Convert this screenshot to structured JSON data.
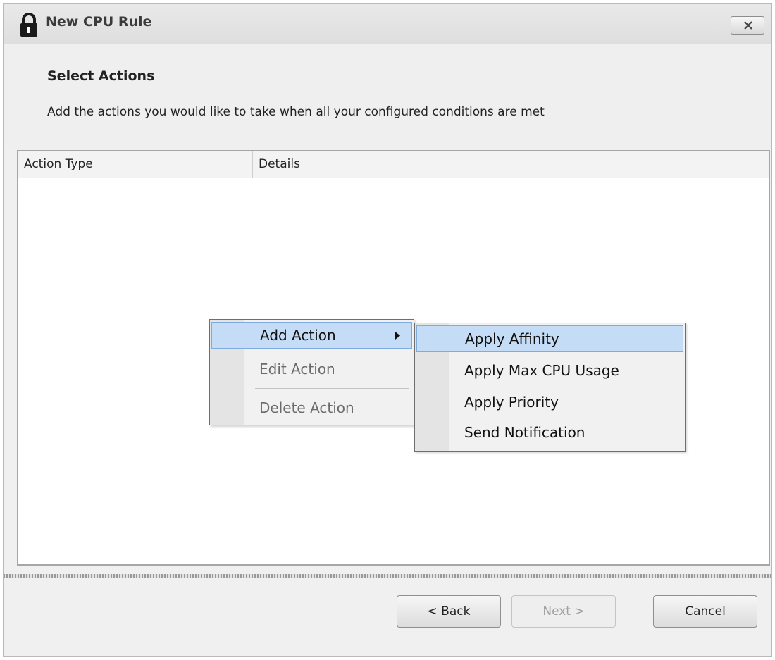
{
  "window": {
    "title": "New CPU Rule",
    "close_icon": "close-x-icon",
    "title_icon": "lock-icon"
  },
  "header": {
    "heading": "Select Actions",
    "subheading": "Add the actions you would like to take when all your configured conditions are met"
  },
  "list": {
    "columns": [
      "Action Type",
      "Details"
    ],
    "rows": []
  },
  "context_menu": {
    "items": [
      {
        "label": "Add Action",
        "state": "highlighted",
        "has_submenu": true
      },
      {
        "label": "Edit Action",
        "state": "disabled"
      },
      {
        "label": "Delete Action",
        "state": "disabled"
      }
    ]
  },
  "submenu": {
    "items": [
      {
        "label": "Apply Affinity",
        "state": "highlighted"
      },
      {
        "label": "Apply Max CPU Usage",
        "state": "normal"
      },
      {
        "label": "Apply Priority",
        "state": "normal"
      },
      {
        "label": "Send Notification",
        "state": "normal"
      }
    ]
  },
  "footer": {
    "back_label": "< Back",
    "next_label": "Next >",
    "cancel_label": "Cancel"
  },
  "colors": {
    "highlight": "#c5dcf6",
    "highlight_border": "#80abdf"
  }
}
